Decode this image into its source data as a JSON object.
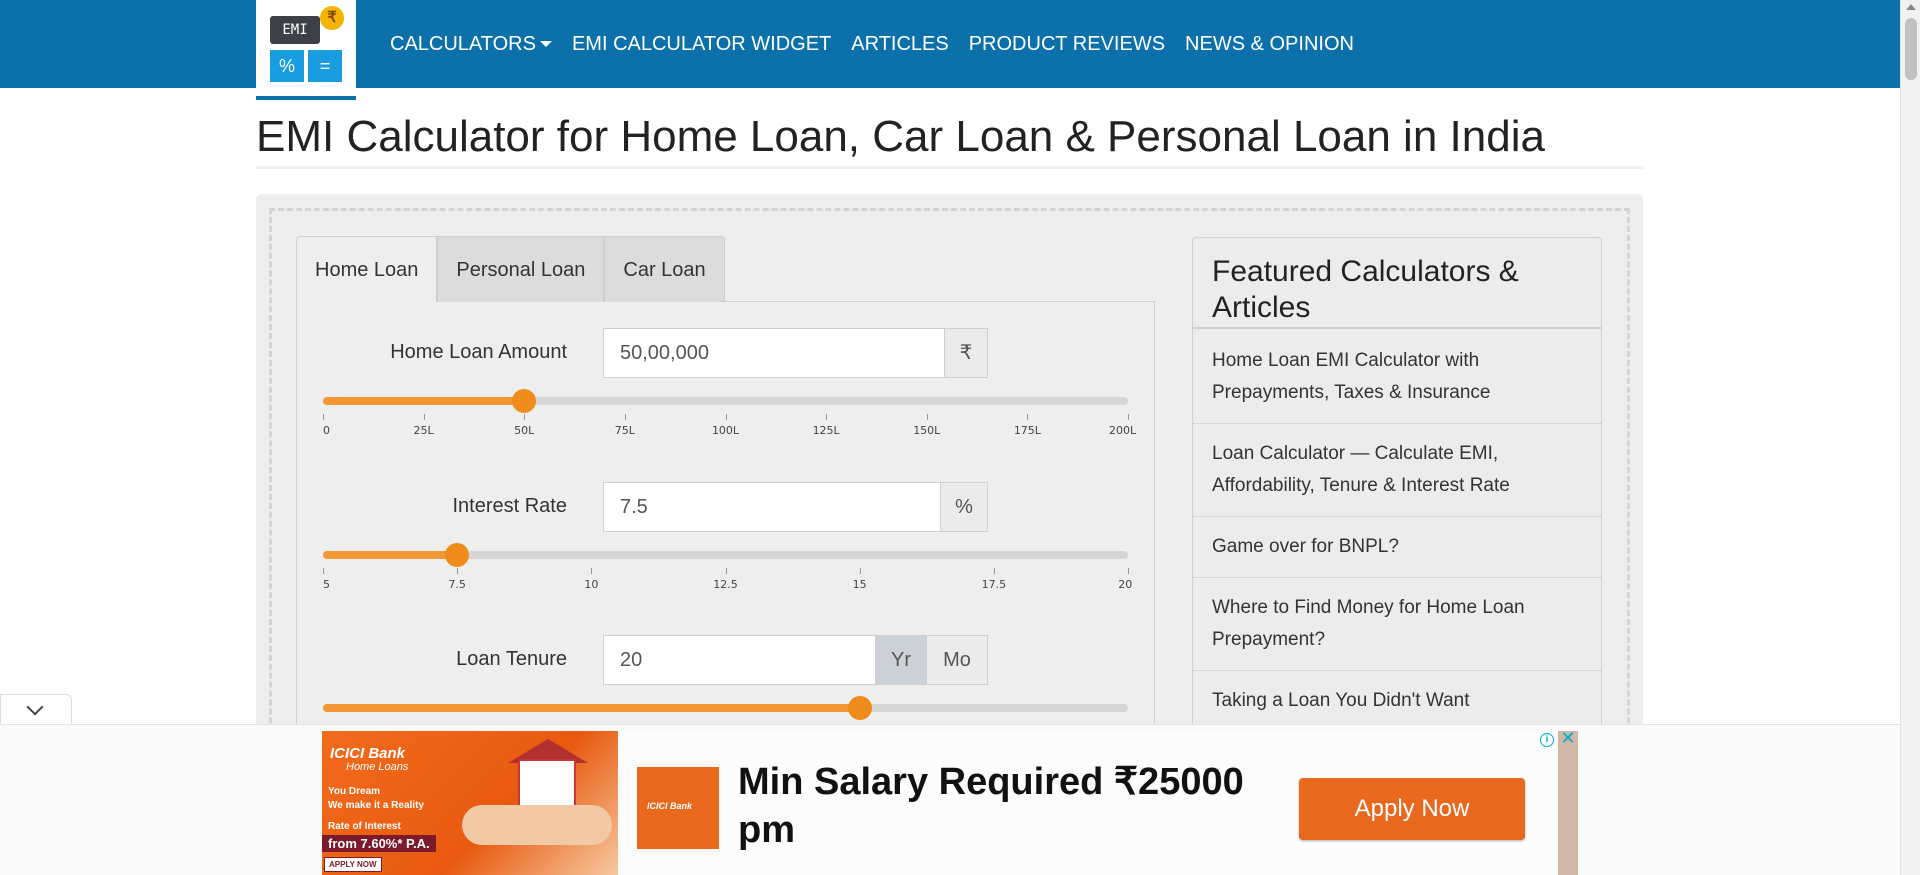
{
  "logo": {
    "screen_text": "EMI",
    "coin_symbol": "₹",
    "key_percent": "%",
    "key_equals": "="
  },
  "nav": {
    "calculators": "CALCULATORS",
    "widget": "EMI CALCULATOR WIDGET",
    "articles": "ARTICLES",
    "reviews": "PRODUCT REVIEWS",
    "news": "NEWS & OPINION"
  },
  "title": "EMI Calculator for Home Loan, Car Loan & Personal Loan in India",
  "tabs": {
    "home": "Home Loan",
    "personal": "Personal Loan",
    "car": "Car Loan",
    "active": "Home Loan"
  },
  "amount": {
    "label": "Home Loan Amount",
    "value": "50,00,000",
    "unit": "₹",
    "slider_fraction": 0.25,
    "ticks": [
      "0",
      "25L",
      "50L",
      "75L",
      "100L",
      "125L",
      "150L",
      "175L",
      "200L"
    ]
  },
  "interest": {
    "label": "Interest Rate",
    "value": "7.5",
    "unit": "%",
    "slider_fraction": 0.1667,
    "ticks": [
      "5",
      "7.5",
      "10",
      "12.5",
      "15",
      "17.5",
      "20"
    ]
  },
  "tenure": {
    "label": "Loan Tenure",
    "value": "20",
    "unit_year": "Yr",
    "unit_month": "Mo",
    "selected_unit": "Yr",
    "slider_fraction": 0.6667
  },
  "featured": {
    "title": "Featured Calculators & Articles",
    "items": [
      "Home Loan EMI Calculator with Prepayments, Taxes & Insurance",
      "Loan Calculator — Calculate EMI, Affordability, Tenure & Interest Rate",
      "Game over for BNPL?",
      "Where to Find Money for Home Loan Prepayment?",
      "Taking a Loan You Didn't Want"
    ]
  },
  "ad": {
    "brand": "ICICI Bank",
    "brand_sub": "Home Loans",
    "tagline": "You Dream\nWe make it a Reality",
    "rate_label": "Rate of Interest",
    "rate": "from 7.60%* P.A.",
    "apply_small": "APPLY NOW",
    "thumb_brand": "ICICI Bank",
    "headline": "Min Salary Required ₹25000 pm",
    "cta": "Apply Now",
    "info_icon": "i",
    "close_icon": "✕"
  },
  "colors": {
    "nav_bg": "#0c71ab",
    "slider_fill": "#f39635",
    "cta": "#e8681d"
  }
}
